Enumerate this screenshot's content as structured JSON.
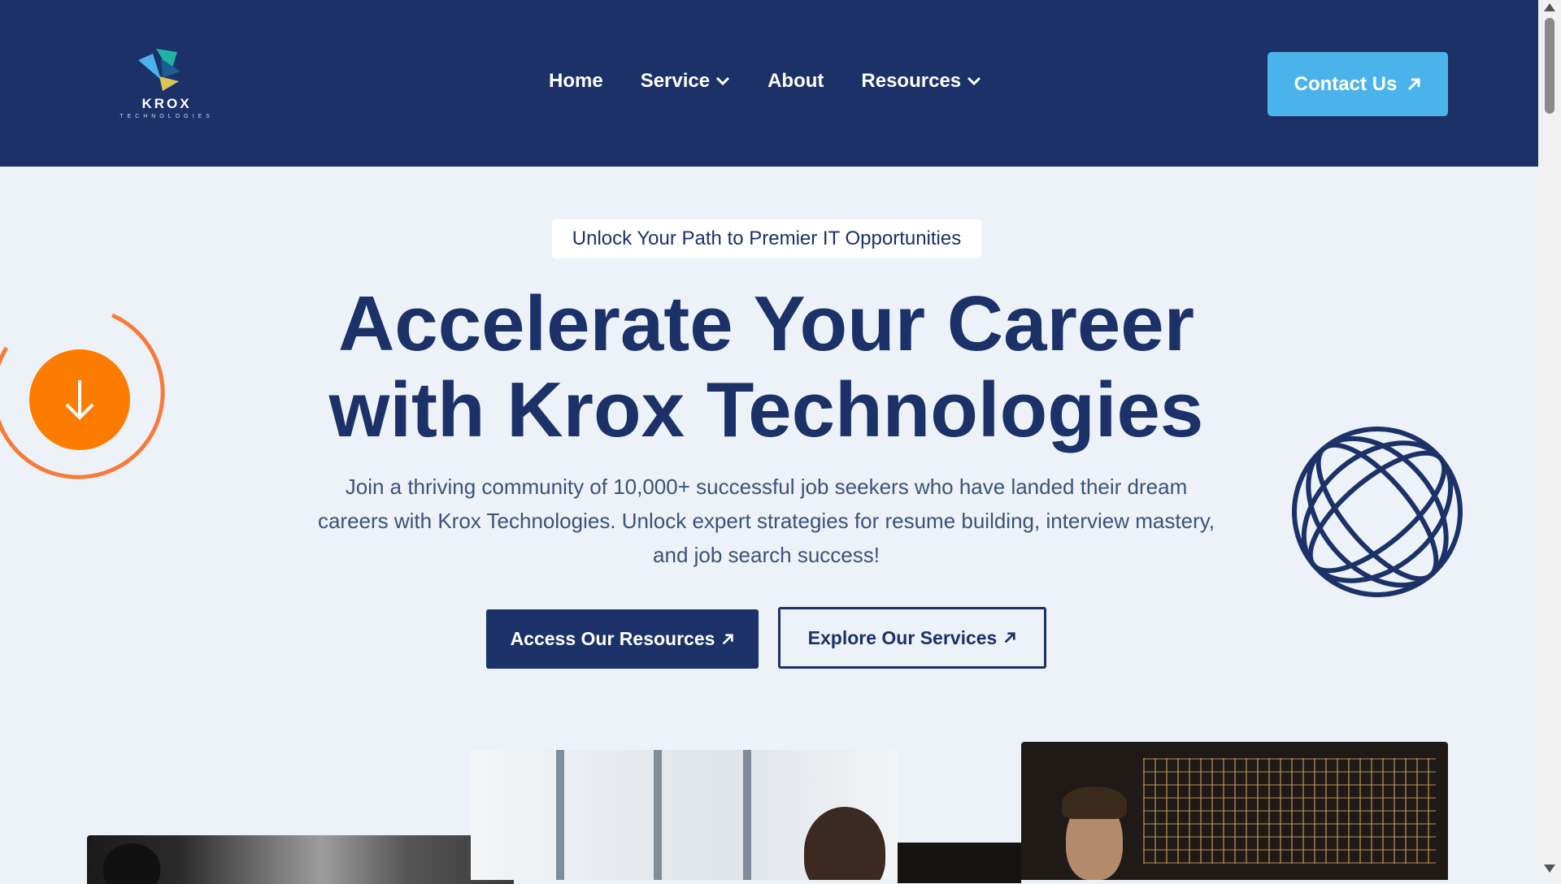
{
  "brand": {
    "name": "KROX",
    "subtitle": "TECHNOLOGIES"
  },
  "nav": {
    "items": [
      {
        "label": "Home",
        "has_dropdown": false
      },
      {
        "label": "Service",
        "has_dropdown": true
      },
      {
        "label": "About",
        "has_dropdown": false
      },
      {
        "label": "Resources",
        "has_dropdown": true
      }
    ],
    "contact_label": "Contact Us"
  },
  "hero": {
    "tagline": "Unlock Your Path to Premier IT Opportunities",
    "headline_line1": "Accelerate Your Career",
    "headline_line2": "with Krox Technologies",
    "description": "Join a thriving community of 10,000+ successful job seekers who have landed their dream careers with Krox Technologies. Unlock expert strategies for resume building, interview mastery, and job search success!",
    "primary_button": "Access Our Resources",
    "secondary_button": "Explore Our Services"
  },
  "icons": {
    "scroll": "arrow-down-icon",
    "globe": "globe-icon",
    "external": "arrow-up-right-icon",
    "dropdown": "chevron-down-icon"
  },
  "colors": {
    "navy": "#1b3168",
    "sky": "#4ab3ea",
    "orange": "#fb7c00",
    "background": "#ecf2f7"
  }
}
